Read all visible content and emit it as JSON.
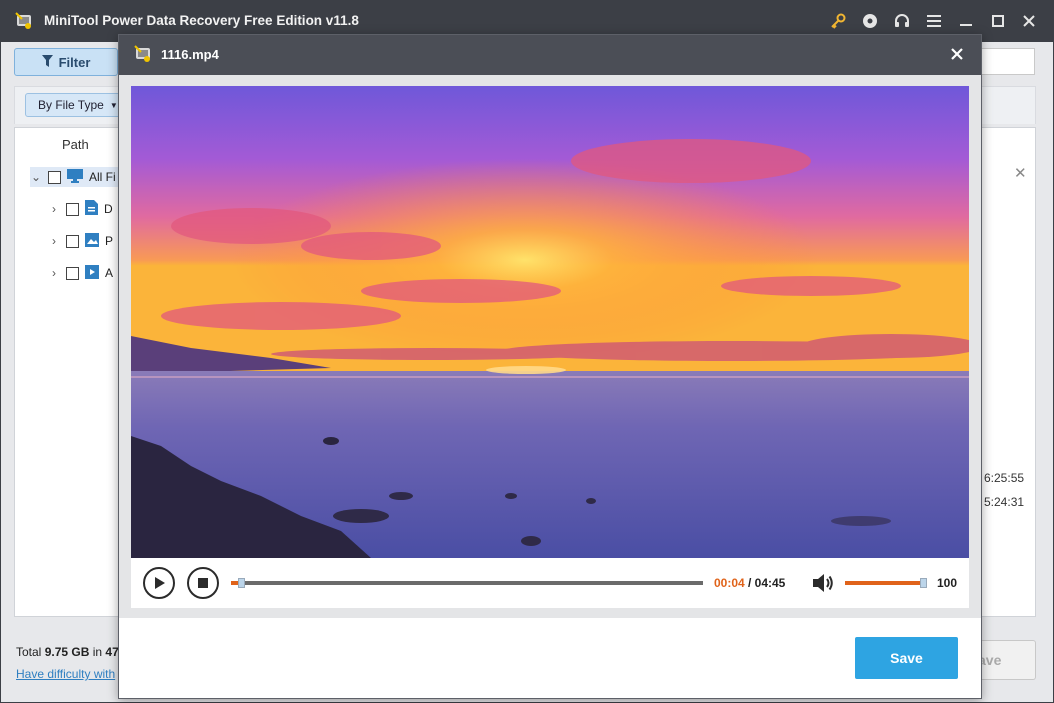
{
  "app": {
    "title": "MiniTool Power Data Recovery Free Edition v11.8",
    "icons": [
      "key-icon",
      "disc-icon",
      "headset-icon",
      "menu-icon",
      "minimize-icon",
      "maximize-icon",
      "close-icon"
    ]
  },
  "toolbar": {
    "filter_label": "Filter",
    "by_file_type_label": "By File Type"
  },
  "tree": {
    "header": "Path",
    "items": [
      {
        "label": "All Fi",
        "icon": "computer-icon",
        "expanded": true
      },
      {
        "label": "D",
        "icon": "document-icon"
      },
      {
        "label": "P",
        "icon": "picture-icon"
      },
      {
        "label": "A",
        "icon": "video-icon"
      }
    ]
  },
  "background_times": [
    "6:25:55",
    "5:24:31"
  ],
  "footer": {
    "total_prefix": "Total ",
    "total_size": "9.75 GB",
    "total_mid": " in ",
    "total_count": "47",
    "help_link": "Have difficulty with",
    "save_partial": "ave"
  },
  "preview": {
    "file_name": "1116.mp4",
    "current_time": "00:04",
    "total_time": "/ 04:45",
    "progress_fraction": 0.014,
    "volume": "100",
    "volume_fraction": 0.92,
    "save_label": "Save",
    "colors": {
      "accent": "#e0631a",
      "save_button": "#2ea4e2",
      "header": "#4b4e56"
    }
  }
}
